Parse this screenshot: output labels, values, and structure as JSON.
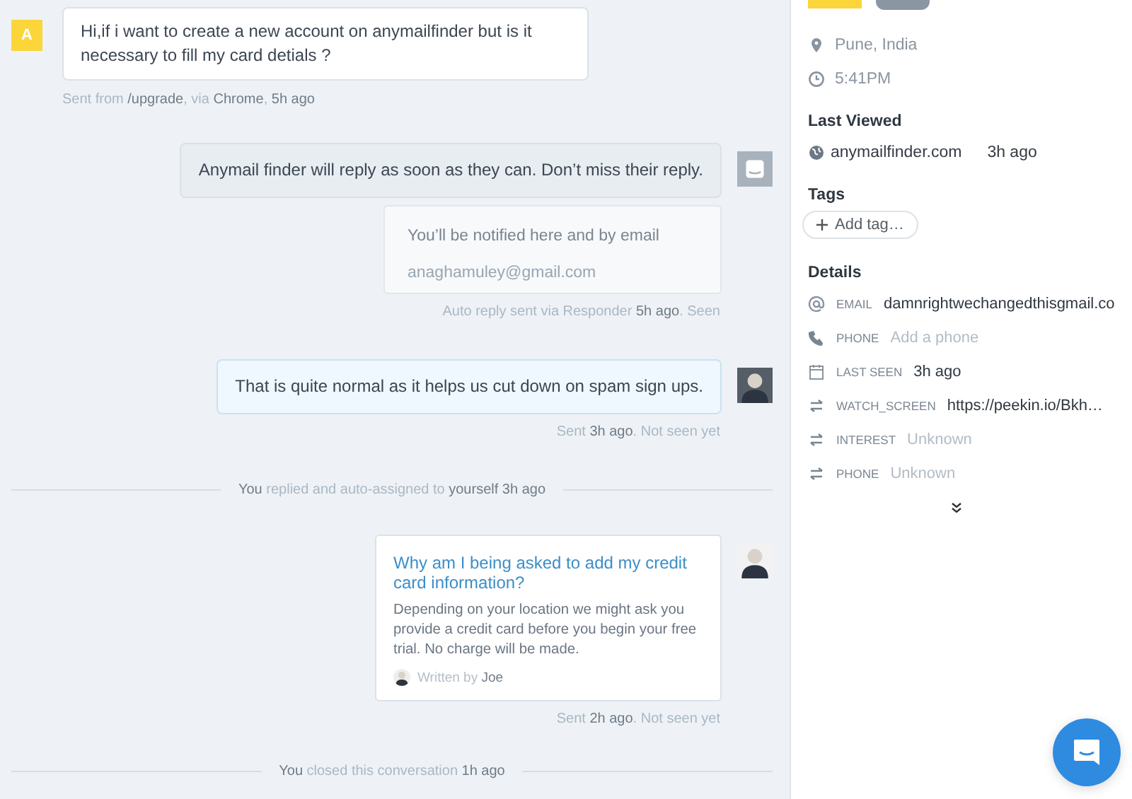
{
  "conversation": {
    "items": [
      {
        "kind": "user",
        "avatar_letter": "A",
        "text": "Hi,if i want to create a new account on anymailfinder but is it necessary to fill my card detials ?",
        "meta": "Sent from **/upgrade**, via **Chrome**, **5h ago**"
      },
      {
        "kind": "bot",
        "text": "Anymail finder will reply as soon as they can. Don’t miss their reply.",
        "form": {
          "hint": "You’ll be notified here and by email",
          "placeholder": "anaghamuley@gmail.com"
        },
        "meta": "Auto reply sent via Responder **5h ago**. Seen"
      },
      {
        "kind": "admin",
        "text": "That is quite normal as it helps us cut down on spam sign ups.",
        "meta": "Sent **3h ago**. Not seen yet"
      },
      {
        "kind": "event",
        "text": "**You** replied and auto-assigned to **yourself 3h ago**"
      },
      {
        "kind": "article",
        "title": "Why am I being asked to add my credit card information?",
        "body": "Depending on your location we might ask you provide a credit card before you begin your free trial. No charge will be made.",
        "byline": "Written by **Joe**",
        "meta": "Sent **2h ago**. Not seen yet"
      },
      {
        "kind": "event",
        "text": "**You** closed this conversation **1h ago**"
      }
    ]
  },
  "profile": {
    "location": "Pune, India",
    "local_time": "5:41PM",
    "last_viewed": {
      "heading": "Last Viewed",
      "site": "anymailfinder.com",
      "time": "3h ago"
    },
    "tags": {
      "heading": "Tags",
      "add_button": "Add tag…"
    },
    "details": {
      "heading": "Details",
      "rows": [
        {
          "kind": "email",
          "label": "EMAIL",
          "value": "damnrightwechangedthisgmail.co",
          "empty": false
        },
        {
          "kind": "phone",
          "label": "PHONE",
          "value": "Add a phone",
          "empty": true
        },
        {
          "kind": "calendar",
          "label": "LAST SEEN",
          "value": "3h ago",
          "empty": false
        },
        {
          "kind": "custom",
          "label": "WATCH_SCREEN",
          "value": "https://peekin.io/Bkh…",
          "empty": false
        },
        {
          "kind": "custom",
          "label": "INTEREST",
          "value": "Unknown",
          "empty": true
        },
        {
          "kind": "custom",
          "label": "PHONE",
          "value": "Unknown",
          "empty": true
        }
      ]
    }
  }
}
